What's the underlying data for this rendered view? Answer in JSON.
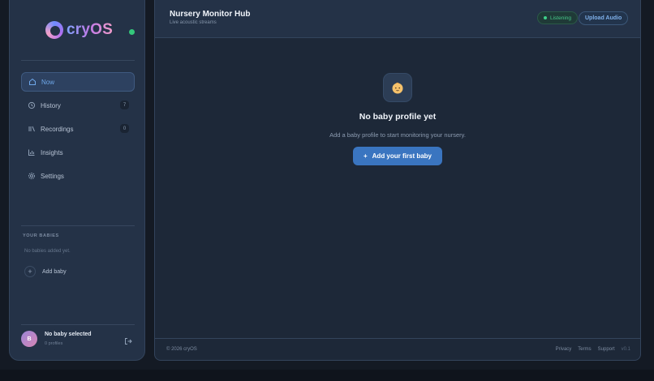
{
  "brand": {
    "name": "cryOS"
  },
  "sidebar": {
    "items": [
      {
        "label": "Now",
        "icon": "home-icon",
        "count": ""
      },
      {
        "label": "History",
        "icon": "history-icon",
        "count": "7"
      },
      {
        "label": "Recordings",
        "icon": "recordings-icon",
        "count": "0"
      },
      {
        "label": "Insights",
        "icon": "bar-chart-icon",
        "count": ""
      },
      {
        "label": "Settings",
        "icon": "gear-icon",
        "count": ""
      }
    ],
    "babies_label": "YOUR BABIES",
    "babies_empty": "No babies added yet.",
    "add_baby": "Add baby",
    "profile": {
      "initial": "B",
      "name": "No baby selected",
      "sub": "0 profiles"
    }
  },
  "header": {
    "title": "Nursery Monitor Hub",
    "subtitle": "Live acoustic streams",
    "status": "Listening",
    "upload": "Upload Audio"
  },
  "empty": {
    "title": "No baby profile yet",
    "description": "Add a baby profile to start monitoring your nursery.",
    "cta": "Add your first baby"
  },
  "footer": {
    "copyright": "© 2026 cryOS",
    "links": [
      "Privacy",
      "Terms",
      "Support"
    ],
    "version": "v0.1"
  },
  "colors": {
    "accent": "#3a75c0",
    "status_green": "#3ed08a",
    "background": "#1d2838"
  }
}
